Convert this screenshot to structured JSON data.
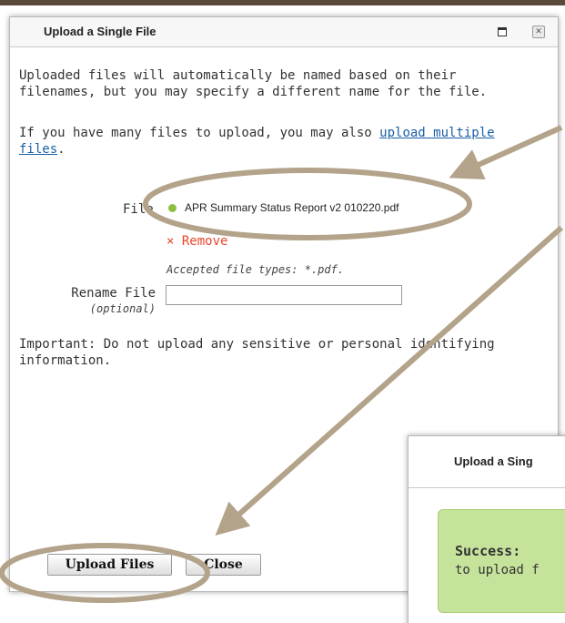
{
  "dialog": {
    "title": "Upload a Single File",
    "intro": "Uploaded files will automatically be named based on their filenames, but you may specify a different name for the file.",
    "multi_prefix": "If you have many files to upload, you may also ",
    "multi_link": "upload multiple files",
    "multi_suffix": ".",
    "file_label": "File",
    "file_name": "APR Summary Status Report v2 010220.pdf",
    "remove_label": "× Remove",
    "accepted_types": "Accepted file types: *.pdf.",
    "rename_label": "Rename File",
    "rename_optional": "(optional)",
    "rename_value": "",
    "important": "Important: Do not upload any sensitive or personal identifying information.",
    "upload_button": "Upload Files",
    "close_button": "Close"
  },
  "second_dialog": {
    "title": "Upload a Sing",
    "success_title": "Success: ",
    "success_text": "to upload f"
  },
  "colors": {
    "accent_link": "#1a5fa8",
    "remove": "#e8462a",
    "status_dot": "#8cbf3f",
    "success_bg": "#c6e39b",
    "annotation": "#b3a38a"
  },
  "icons": [
    "maximize-icon",
    "close-icon",
    "status-dot-icon",
    "arrow-icon"
  ]
}
